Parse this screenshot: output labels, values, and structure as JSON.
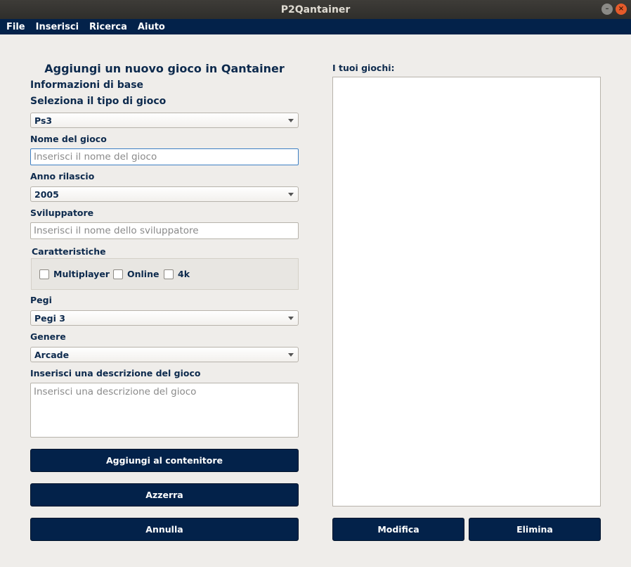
{
  "window": {
    "title": "P2Qantainer",
    "minimize_glyph": "–",
    "close_glyph": "×"
  },
  "menu": {
    "items": [
      "File",
      "Inserisci",
      "Ricerca",
      "Aiuto"
    ]
  },
  "form": {
    "heading": "Aggiungi un nuovo gioco in Qantainer",
    "section_basic": "Informazioni di base",
    "type_label": "Seleziona il tipo di gioco",
    "type_value": "Ps3",
    "name_label": "Nome del gioco",
    "name_placeholder": "Inserisci il nome del gioco",
    "year_label": "Anno rilascio",
    "year_value": "2005",
    "developer_label": "Sviluppatore",
    "developer_placeholder": "Inserisci il nome dello sviluppatore",
    "features_label": "Caratteristiche",
    "features": {
      "multiplayer": "Multiplayer",
      "online": "Online",
      "k4": "4k"
    },
    "pegi_label": "Pegi",
    "pegi_value": "Pegi 3",
    "genre_label": "Genere",
    "genre_value": "Arcade",
    "desc_label": "Inserisci una descrizione del gioco",
    "desc_placeholder": "Inserisci una descrizione del gioco",
    "add_button": "Aggiungi al contenitore",
    "reset_button": "Azzerra",
    "cancel_button": "Annulla"
  },
  "games": {
    "label": "I tuoi giochi:",
    "edit_button": "Modifica",
    "delete_button": "Elimina"
  }
}
